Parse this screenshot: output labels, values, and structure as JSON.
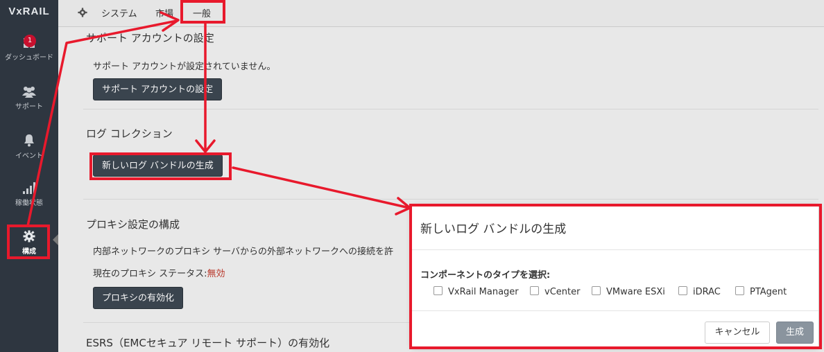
{
  "sidebar": {
    "logo": "VxRAIL",
    "items": [
      {
        "label": "ダッシュボード",
        "icon": "dashboard-icon",
        "badge": "1"
      },
      {
        "label": "サポート",
        "icon": "users-icon"
      },
      {
        "label": "イベント",
        "icon": "bell-icon"
      },
      {
        "label": "稼働状態",
        "icon": "signal-bars-icon"
      },
      {
        "label": "構成",
        "icon": "gear-icon"
      }
    ]
  },
  "topbar": {
    "tabs": [
      {
        "label": "システム"
      },
      {
        "label": "市場"
      },
      {
        "label": "一般"
      }
    ]
  },
  "main": {
    "support": {
      "title": "サポート アカウントの設定",
      "status": "サポート アカウントが設定されていません。",
      "button": "サポート アカウントの設定"
    },
    "log": {
      "title": "ログ コレクション",
      "button": "新しいログ バンドルの生成"
    },
    "proxy": {
      "title": "プロキシ設定の構成",
      "description": "内部ネットワークのプロキシ サーバからの外部ネットワークへの接続を許",
      "status_label": "現在のプロキシ ステータス:",
      "status_value": "無効",
      "button": "プロキシの有効化"
    },
    "esrs": {
      "title": "ESRS（EMCセキュア リモート サポート）の有効化"
    }
  },
  "dialog": {
    "title": "新しいログ バンドルの生成",
    "label": "コンポーネントのタイプを選択:",
    "options": [
      "VxRail Manager",
      "vCenter",
      "VMware ESXi",
      "iDRAC",
      "PTAgent"
    ],
    "cancel": "キャンセル",
    "generate": "生成"
  },
  "colors": {
    "sidebar_bg": "#2e3640",
    "annotation": "#e8192c",
    "disabled_status": "#c0392b",
    "dark_button": "#3d4752"
  }
}
